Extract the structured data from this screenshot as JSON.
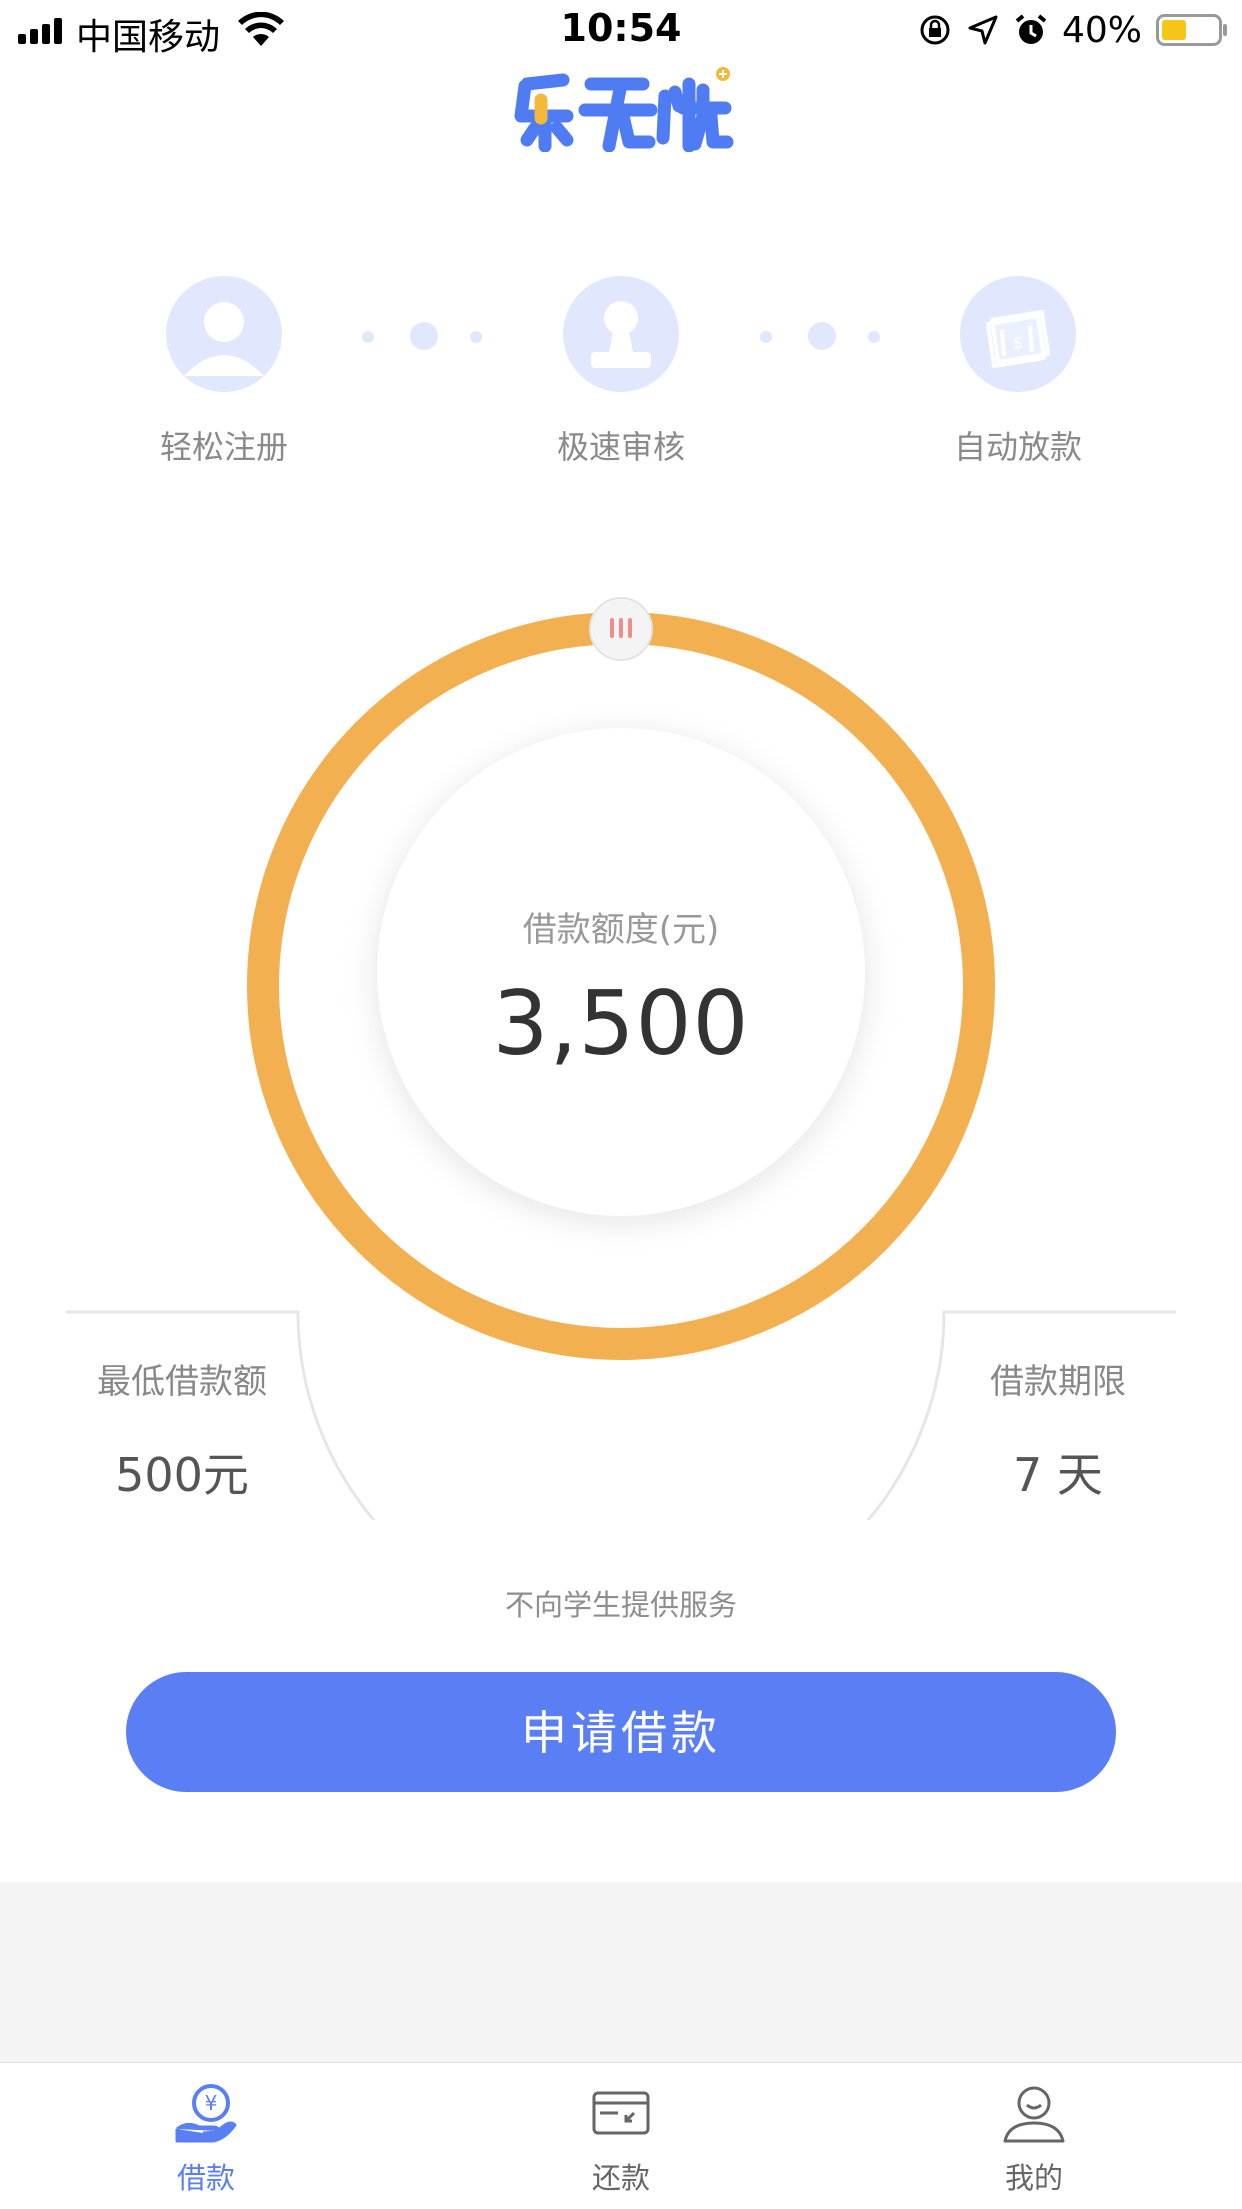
{
  "status_bar": {
    "carrier": "中国移动",
    "time": "10:54",
    "battery": "40%"
  },
  "app": {
    "logo_text": "乐无忧",
    "brand_color": "#5a7ff4",
    "accent_color": "#f2b050"
  },
  "steps": [
    {
      "label": "轻松注册",
      "icon": "user-icon"
    },
    {
      "label": "极速审核",
      "icon": "stamp-icon"
    },
    {
      "label": "自动放款",
      "icon": "money-stack-icon"
    }
  ],
  "dial": {
    "title": "借款额度(元)",
    "amount": "3,500",
    "handle_icon": "drag-handle-icon"
  },
  "min_amount": {
    "label": "最低借款额",
    "value": "500元"
  },
  "term": {
    "label": "借款期限",
    "value": "7 天"
  },
  "notice": "不向学生提供服务",
  "apply_button": "申请借款",
  "tabs": [
    {
      "label": "借款",
      "icon": "loan-icon",
      "active": true
    },
    {
      "label": "还款",
      "icon": "repay-icon",
      "active": false
    },
    {
      "label": "我的",
      "icon": "profile-icon",
      "active": false
    }
  ]
}
